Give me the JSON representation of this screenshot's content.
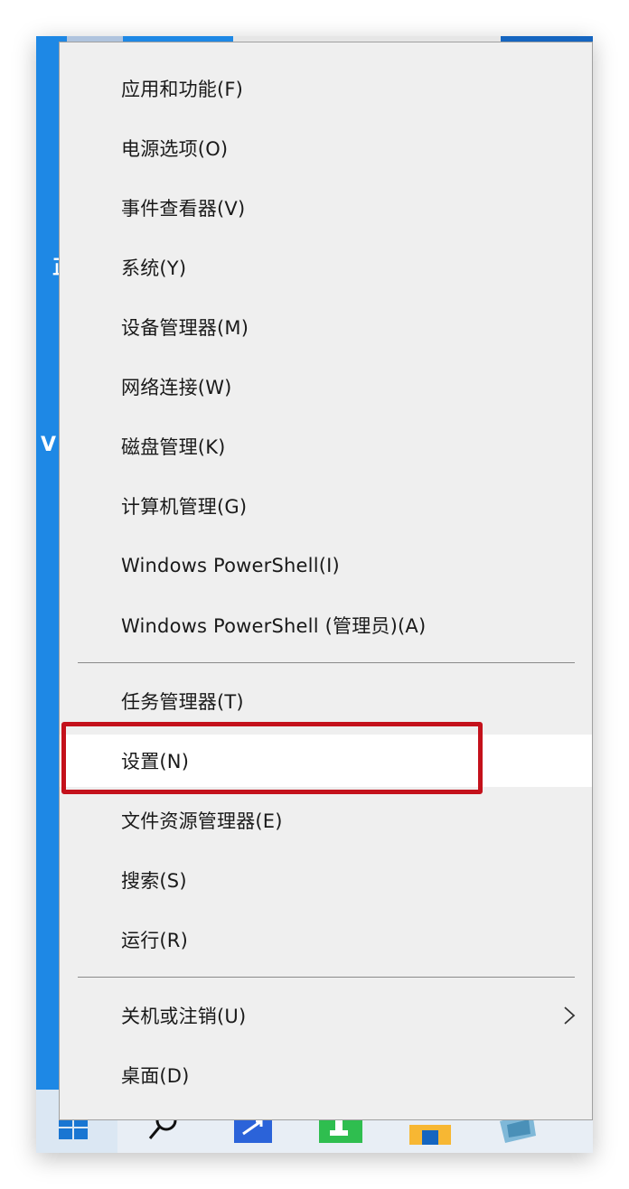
{
  "desktop": {
    "glyphs": [
      "正",
      "V"
    ]
  },
  "menu": {
    "groups": [
      {
        "items": [
          {
            "label": "应用和功能(F)",
            "name": "menu-item-apps-and-features"
          },
          {
            "label": "电源选项(O)",
            "name": "menu-item-power-options"
          },
          {
            "label": "事件查看器(V)",
            "name": "menu-item-event-viewer"
          },
          {
            "label": "系统(Y)",
            "name": "menu-item-system"
          },
          {
            "label": "设备管理器(M)",
            "name": "menu-item-device-manager"
          },
          {
            "label": "网络连接(W)",
            "name": "menu-item-network-connections"
          },
          {
            "label": "磁盘管理(K)",
            "name": "menu-item-disk-management"
          },
          {
            "label": "计算机管理(G)",
            "name": "menu-item-computer-management"
          },
          {
            "label": "Windows PowerShell(I)",
            "name": "menu-item-powershell"
          },
          {
            "label": "Windows PowerShell (管理员)(A)",
            "name": "menu-item-powershell-admin"
          }
        ]
      },
      {
        "items": [
          {
            "label": "任务管理器(T)",
            "name": "menu-item-task-manager"
          },
          {
            "label": "设置(N)",
            "name": "menu-item-settings",
            "hovered": true,
            "highlighted": true
          },
          {
            "label": "文件资源管理器(E)",
            "name": "menu-item-file-explorer"
          },
          {
            "label": "搜索(S)",
            "name": "menu-item-search"
          },
          {
            "label": "运行(R)",
            "name": "menu-item-run"
          }
        ]
      },
      {
        "items": [
          {
            "label": "关机或注销(U)",
            "name": "menu-item-shutdown-or-sign-out",
            "submenu": true
          },
          {
            "label": "桌面(D)",
            "name": "menu-item-desktop"
          }
        ]
      }
    ]
  },
  "highlight": {
    "color": "#c4111b",
    "target": "设置(N)"
  },
  "taskbar": {
    "icons": [
      "windows-start-icon",
      "search-icon",
      "app-icon-blue",
      "app-icon-green",
      "file-explorer-icon",
      "app-icon-teal"
    ]
  },
  "colors": {
    "desktop": "#1e88e5",
    "menu_background": "#efefef",
    "menu_hover": "#ffffff",
    "separator": "#8a8a8a"
  }
}
